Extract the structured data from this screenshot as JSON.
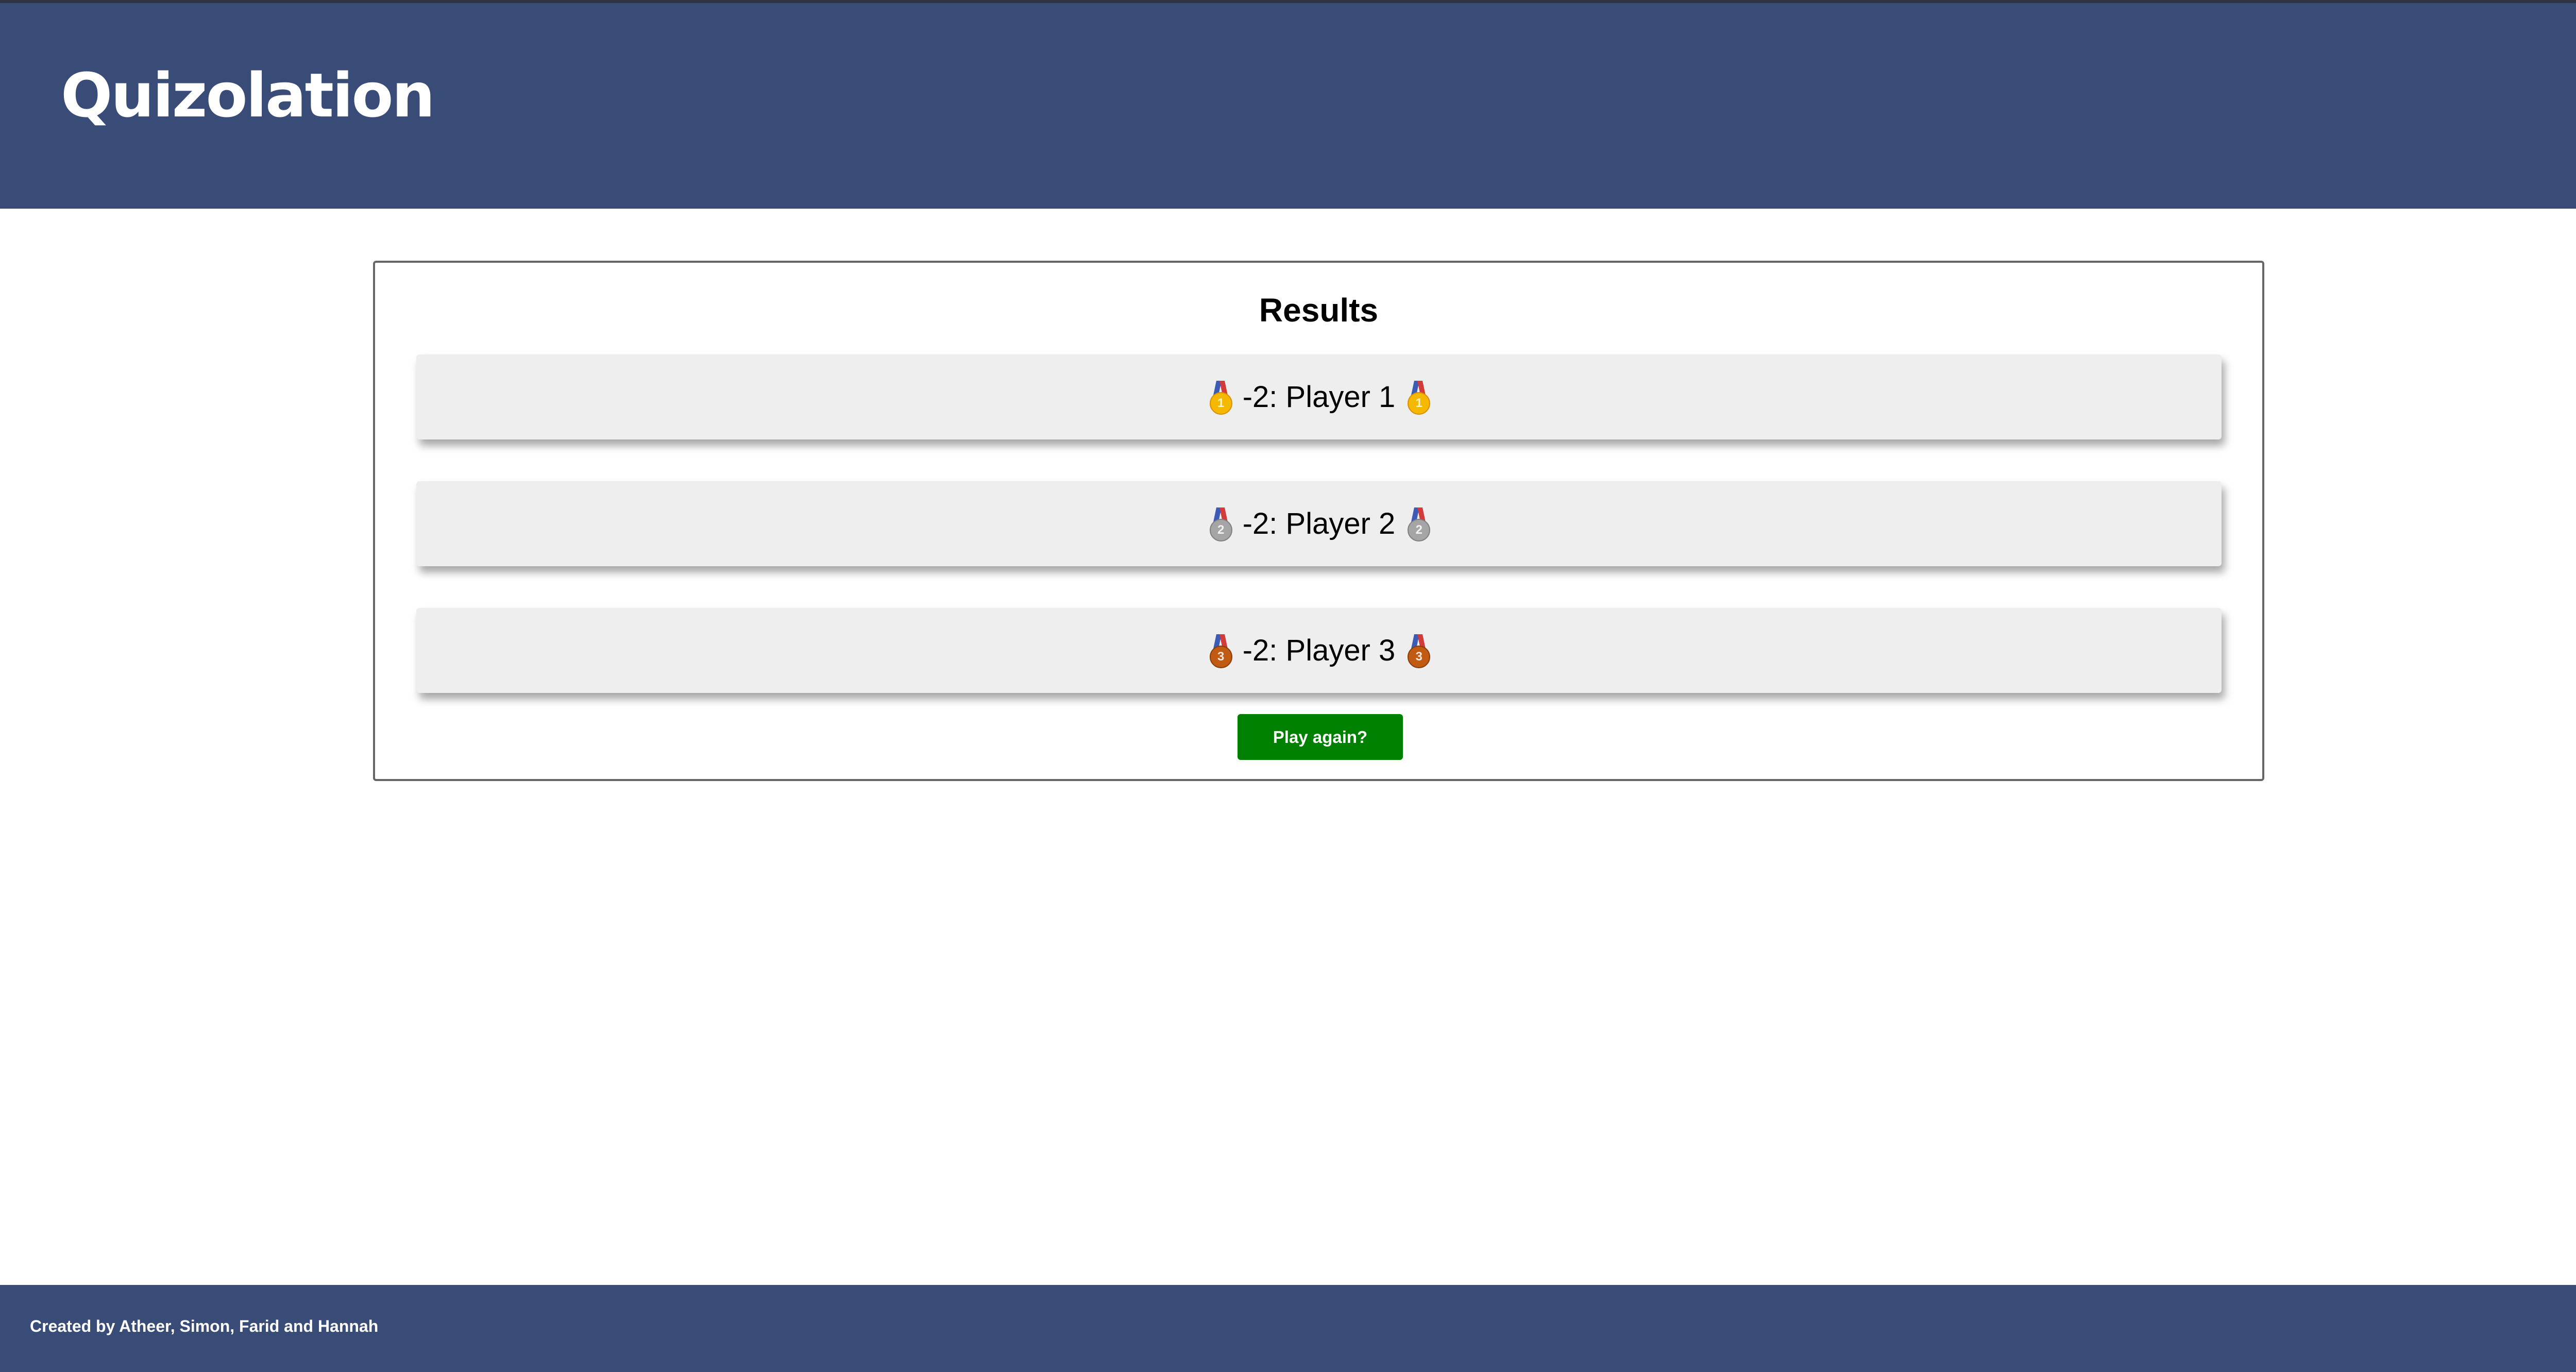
{
  "app": {
    "title": "Quizolation"
  },
  "results": {
    "heading": "Results",
    "rows": [
      {
        "medal_icon": "gold-medal-icon",
        "medal_number": "1",
        "text": "-2: Player 1",
        "medal_color": "#f5b800"
      },
      {
        "medal_icon": "silver-medal-icon",
        "medal_number": "2",
        "text": "-2: Player 2",
        "medal_color": "#a5a5a5"
      },
      {
        "medal_icon": "bronze-medal-icon",
        "medal_number": "3",
        "text": "-2: Player 3",
        "medal_color": "#c15a12"
      }
    ],
    "play_again_label": "Play again?"
  },
  "footer": {
    "credits": "Created by Atheer, Simon, Farid and Hannah"
  },
  "colors": {
    "brand": "#394b77",
    "button": "#008000",
    "row_background": "#eeeeee"
  }
}
